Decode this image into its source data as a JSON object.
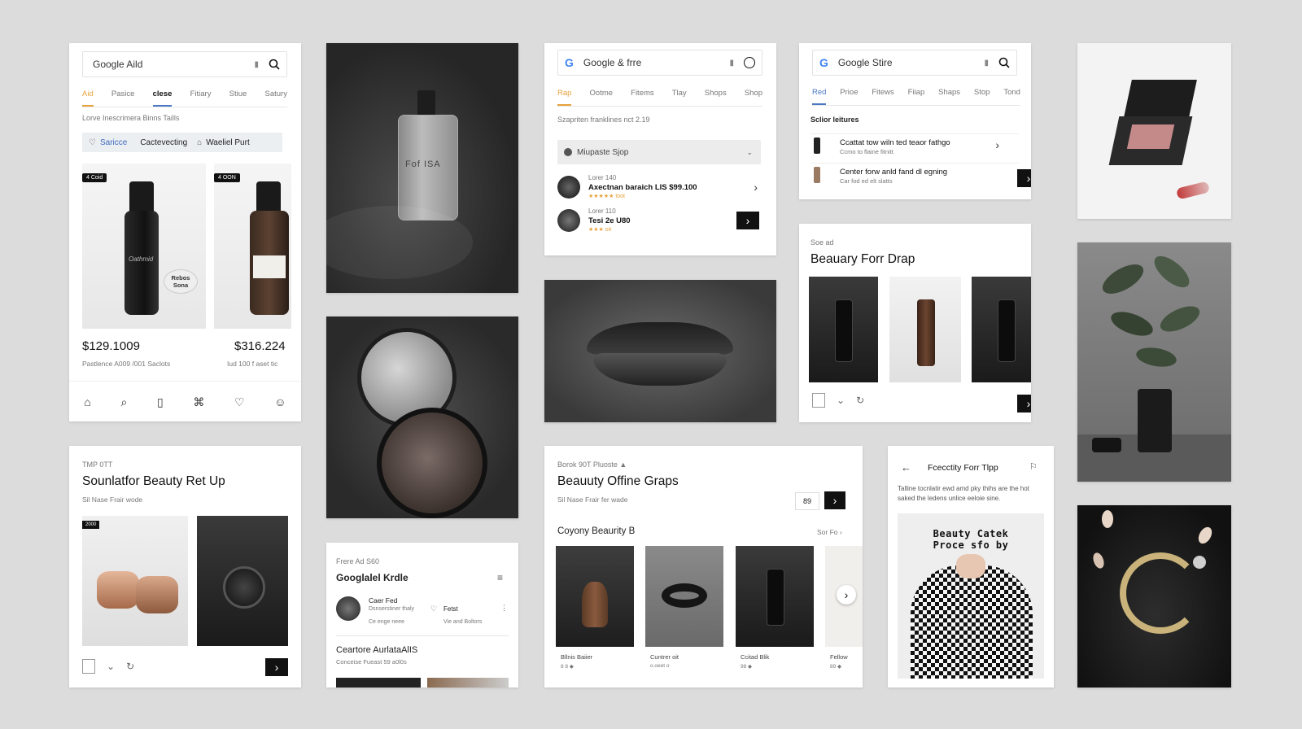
{
  "card1": {
    "search": {
      "text": "Google Aild"
    },
    "tabs": [
      "Aid",
      "Pasice",
      "clese",
      "Fitiary",
      "Stiue",
      "Satury"
    ],
    "subtitle": "Lorve Inescrimera Binns Taills",
    "filters": [
      "Saricce",
      "Cactevecting",
      "Waeliel Purt"
    ],
    "products": [
      {
        "badge": "4 Coid",
        "label": "Rebos Sona",
        "price": "$129.1009",
        "desc": "Pastlence A009 /001 Saclots"
      },
      {
        "badge": "4 OON",
        "price": "$316.224",
        "desc": "Iud 100 f aset tic"
      }
    ]
  },
  "card2": {
    "search": {
      "text": "Google & frre"
    },
    "tabs": [
      "Rap",
      "Ootme",
      "Fitems",
      "Tlay",
      "Shops",
      "Shop"
    ],
    "subtitle": "Szapriten franklines nct 2.19",
    "dropdown": "Miupaste Sjop",
    "items": [
      {
        "line1": "Lorer 140",
        "line2": "Axectnan baraich LIS $99.100",
        "stars": "★★★★★ toot"
      },
      {
        "line1": "Lorer 110",
        "line2": "Tesi 2e U80",
        "stars": "★★★ oit"
      }
    ]
  },
  "card3": {
    "search": {
      "text": "Google Stire"
    },
    "tabs": [
      "Red",
      "Prioe",
      "Fitews",
      "Fiiap",
      "Shaps",
      "Stop",
      "Tond"
    ],
    "section": "Sclior leitures",
    "items": [
      {
        "title": "Ccattat tow wiln ted teaor fathgo",
        "sub": "Ccmo to flaine fitnitt"
      },
      {
        "title": "Center forw anld fand dl egning",
        "sub": "Car fod ed elt slatts"
      }
    ]
  },
  "card4": {
    "kicker": "Soe ad",
    "title": "Beauary Forr Drap"
  },
  "card5": {
    "kicker": "TMP 0TT",
    "title": "Sounlatfor Beauty Ret Up",
    "sub": "Sil Nase Frair wode",
    "badge": "2000"
  },
  "card6": {
    "kicker": "Frere Ad S60",
    "title": "Googlalel Krdle",
    "item": {
      "title": "Caer Fed",
      "sub1": "Dsnserstiner thaly",
      "sub2": "Ce enge neee",
      "right": "Fetst",
      "right_sub": "Vie and Boltors"
    },
    "section": "Ceartore AurlataAlIS",
    "section_sub": "Conceise Fueast 59 a0l0s"
  },
  "card7": {
    "kicker": "Borok 90T Pluoste ▲",
    "title": "Beauuty Offine Graps",
    "sub": "Sil Nase Frair fer wade",
    "count": "89",
    "section": "Coyony Beaurity B",
    "see_all": "Sor Fo ›",
    "items": [
      {
        "name": "Bllnis Baiier",
        "sub": "8 8 ◆"
      },
      {
        "name": "Cuntrer oit",
        "sub": "o.oeet o"
      },
      {
        "name": "Ccitad Blik",
        "sub": "98 ◆"
      },
      {
        "name": "Fellow",
        "sub": "89 ◆"
      }
    ]
  },
  "card8": {
    "title": "Fcecctity Forr Tlpp",
    "desc": "Talline tocnlatir ewd amd pky thihs are the hot saked the ledens unlice eeloie sine.",
    "poster": "Beauty Catek Proce sfo by"
  },
  "photos": {
    "perfume_label": "Fof ISA",
    "bottle_label": "Oathmid"
  },
  "colors": {
    "accent_orange": "#e8a23c",
    "accent_blue": "#4a78c4",
    "dark": "#111111",
    "background": "#dcdcdc"
  },
  "icons": [
    "search-icon",
    "mic-icon",
    "home-icon",
    "heart-icon",
    "user-icon",
    "bag-icon",
    "chevron-right-icon",
    "back-arrow-icon",
    "menu-icon"
  ]
}
